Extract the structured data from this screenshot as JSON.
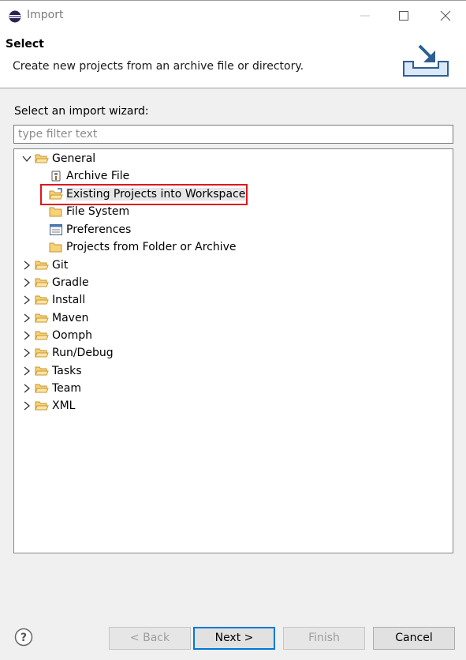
{
  "window": {
    "title": "Import"
  },
  "header": {
    "title": "Select",
    "description": "Create new projects from an archive file or directory."
  },
  "wizard": {
    "label": "Select an import wizard:",
    "filter_placeholder": "type filter text",
    "filter_value": ""
  },
  "tree": {
    "general": {
      "label": "General",
      "children": [
        {
          "label": "Archive File",
          "icon": "archive-icon"
        },
        {
          "label": "Existing Projects into Workspace",
          "icon": "folder-import-icon",
          "selected": true
        },
        {
          "label": "File System",
          "icon": "folder-icon"
        },
        {
          "label": "Preferences",
          "icon": "preferences-icon"
        },
        {
          "label": "Projects from Folder or Archive",
          "icon": "folder-icon"
        }
      ]
    },
    "categories": [
      "Git",
      "Gradle",
      "Install",
      "Maven",
      "Oomph",
      "Run/Debug",
      "Tasks",
      "Team",
      "XML"
    ]
  },
  "buttons": {
    "back": "< Back",
    "next": "Next >",
    "finish": "Finish",
    "cancel": "Cancel"
  },
  "colors": {
    "highlight": "#e2151b",
    "folder": "#e8b547",
    "primary_focus": "#0078d7"
  }
}
